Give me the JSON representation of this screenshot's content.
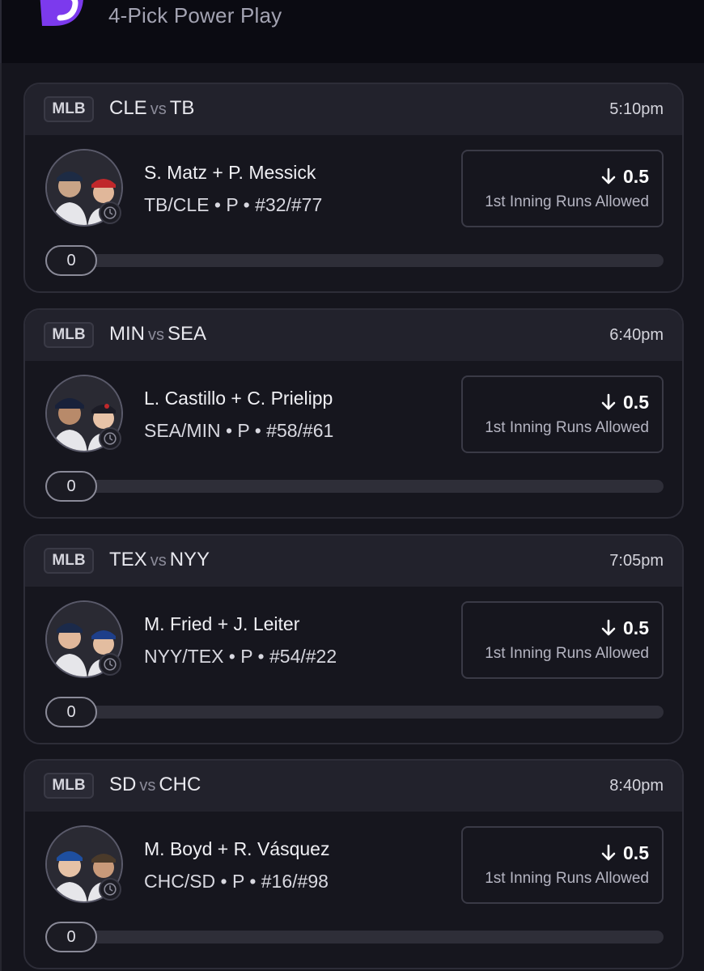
{
  "header": {
    "title": "4-Pick Power Play",
    "logo": "prizepicks-logo-icon",
    "brand_color": "#7c3aed"
  },
  "cards": [
    {
      "league": "MLB",
      "home": "CLE",
      "vs": "vs",
      "away": "TB",
      "time": "5:10pm",
      "players": "S. Matz + P. Messick",
      "meta": "TB/CLE • P • #32/#77",
      "line": "0.5",
      "direction": "down-arrow-icon",
      "stat": "1st Inning Runs Allowed",
      "progress": "0"
    },
    {
      "league": "MLB",
      "home": "MIN",
      "vs": "vs",
      "away": "SEA",
      "time": "6:40pm",
      "players": "L. Castillo + C. Prielipp",
      "meta": "SEA/MIN • P • #58/#61",
      "line": "0.5",
      "direction": "down-arrow-icon",
      "stat": "1st Inning Runs Allowed",
      "progress": "0"
    },
    {
      "league": "MLB",
      "home": "TEX",
      "vs": "vs",
      "away": "NYY",
      "time": "7:05pm",
      "players": "M. Fried + J. Leiter",
      "meta": "NYY/TEX • P • #54/#22",
      "line": "0.5",
      "direction": "down-arrow-icon",
      "stat": "1st Inning Runs Allowed",
      "progress": "0"
    },
    {
      "league": "MLB",
      "home": "SD",
      "vs": "vs",
      "away": "CHC",
      "time": "8:40pm",
      "players": "M. Boyd + R. Vásquez",
      "meta": "CHC/SD • P • #16/#98",
      "line": "0.5",
      "direction": "down-arrow-icon",
      "stat": "1st Inning Runs Allowed",
      "progress": "0"
    }
  ]
}
